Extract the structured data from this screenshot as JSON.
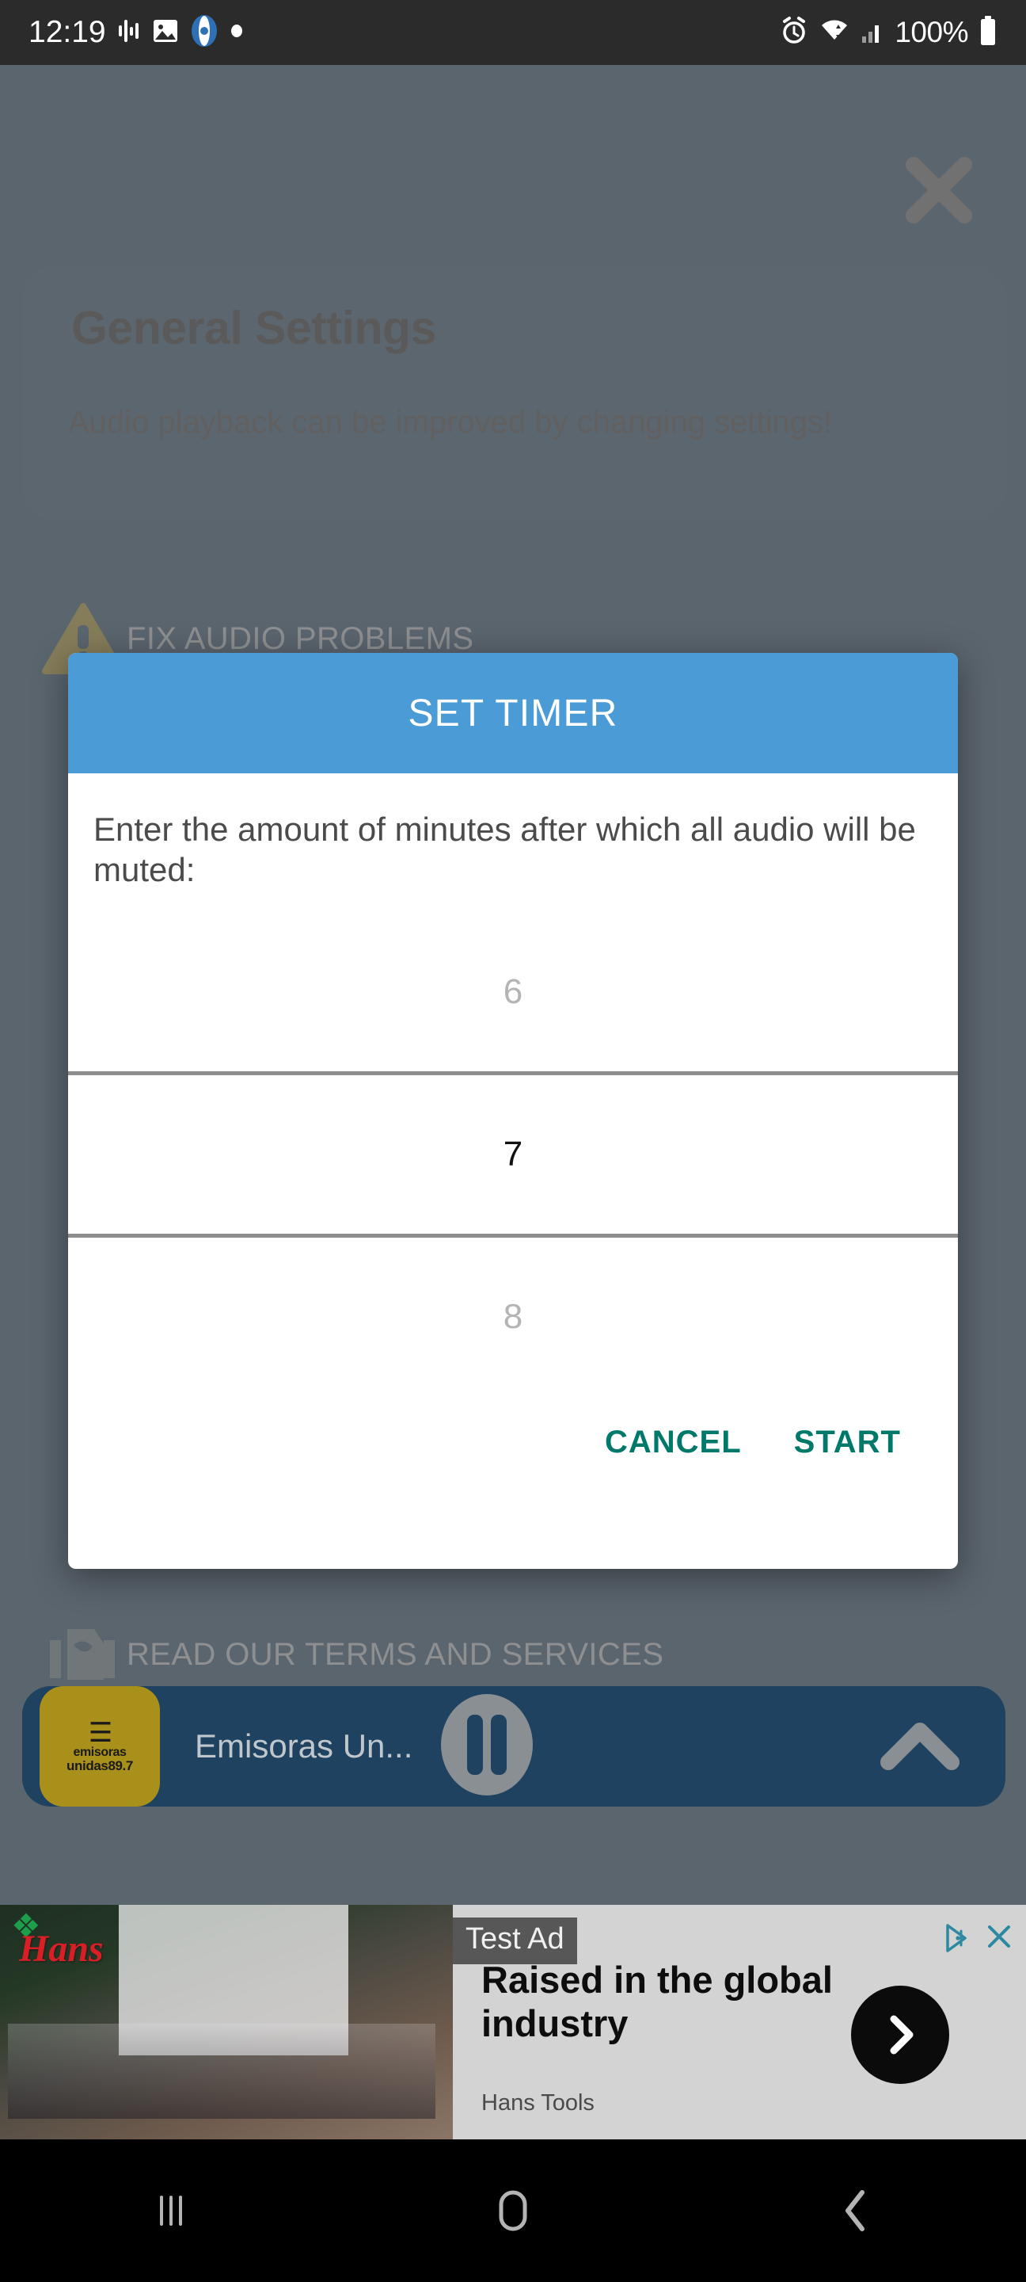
{
  "status_bar": {
    "time": "12:19",
    "battery_percent": "100%",
    "icons_left": [
      "signal-bars-icon",
      "image-icon",
      "flag-badge-icon",
      "dot-icon"
    ],
    "icons_right": [
      "alarm-icon",
      "wifi-icon",
      "cellular-signal-icon",
      "battery-icon"
    ]
  },
  "app": {
    "background_color": "#1e4260",
    "close_label": "×",
    "page_title": "General Settings",
    "page_description": "Audio playback can be improved by changing settings!",
    "rows": [
      {
        "id": "fix-audio",
        "label": "FIX AUDIO PROBLEMS",
        "icon": "warning-triangle-icon"
      },
      {
        "id": "mute-timer",
        "label": "",
        "icon": "timer-icon"
      },
      {
        "id": "buffer",
        "label": "",
        "icon": "buffer-icon"
      },
      {
        "id": "equalizer",
        "label": "",
        "icon": "equalizer-icon"
      },
      {
        "id": "bitrate",
        "label": "",
        "icon": "rate-icon"
      },
      {
        "id": "theme",
        "label": "",
        "icon": "theme-icon"
      },
      {
        "id": "terms",
        "label": "READ OUR TERMS AND SERVICES",
        "icon": "document-icon"
      }
    ]
  },
  "player": {
    "station_logo_line1": "emisoras",
    "station_logo_line2": "unidas",
    "station_logo_freq": "89.7",
    "station_name": "Emisoras Un...",
    "play_pause_state": "pause-icon",
    "expand_icon": "chevron-up-icon"
  },
  "ad": {
    "brand": "Hans",
    "test_label": "Test Ad",
    "headline": "Raised in the global industry",
    "advertiser": "Hans Tools",
    "cta_icon": "chevron-right-icon",
    "adchoices_icon": "adchoices-icon",
    "close_icon": "close-x-icon"
  },
  "dialog": {
    "title": "SET TIMER",
    "message": "Enter the amount of minutes after which all audio will be muted:",
    "picker": {
      "previous_value": "6",
      "selected_value": "7",
      "next_value": "8"
    },
    "cancel_label": "CANCEL",
    "start_label": "START",
    "header_color": "#4a9bd6",
    "action_color": "#00796b"
  },
  "navbar": {
    "recents_icon": "recents-icon",
    "home_icon": "home-icon",
    "back_icon": "back-icon"
  }
}
